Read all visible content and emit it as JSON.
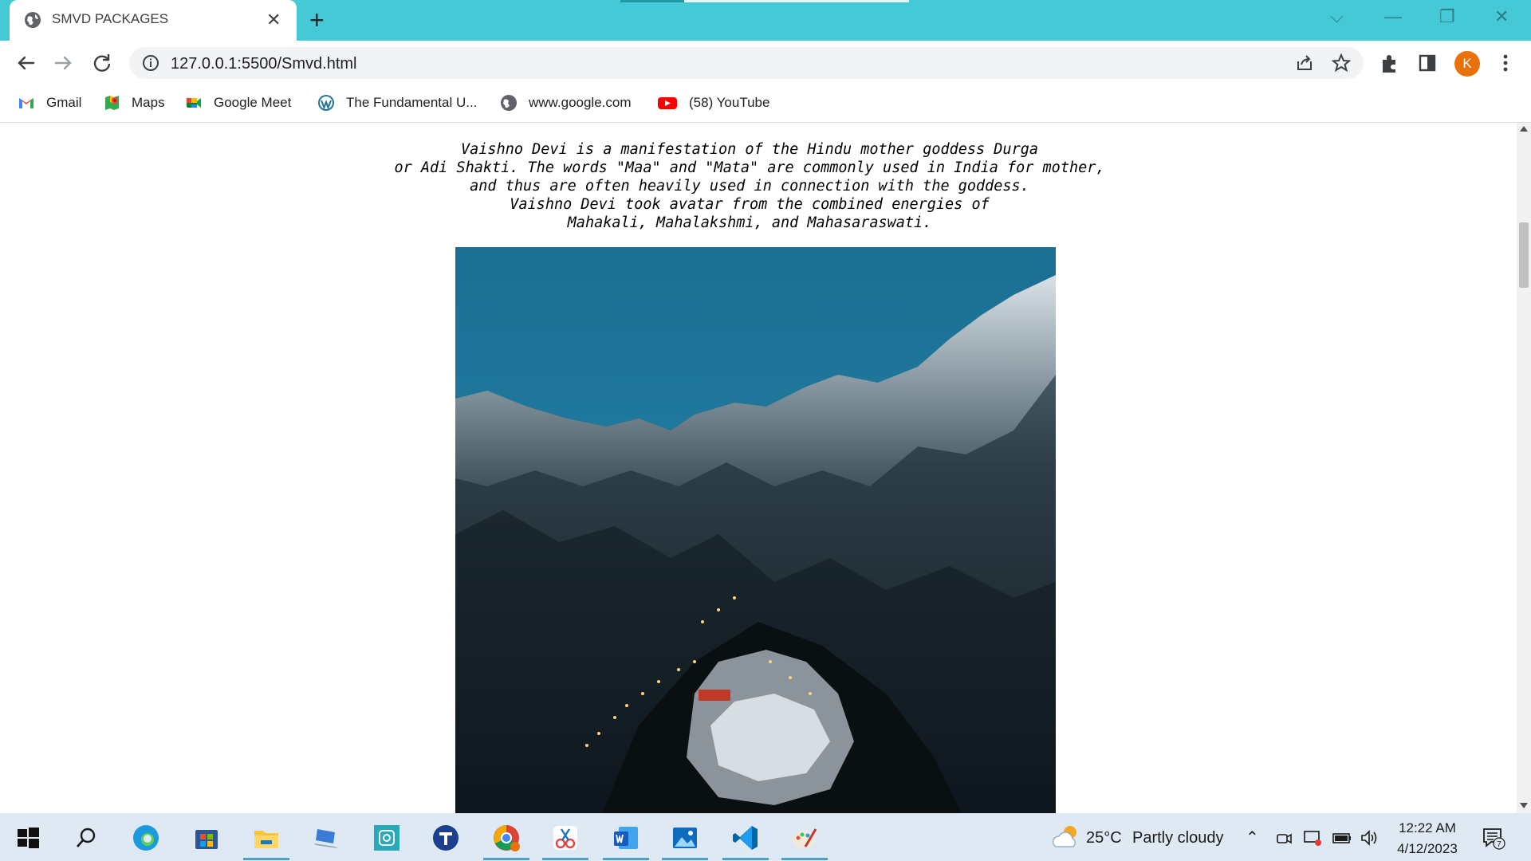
{
  "browser": {
    "tab_title": "SMVD PACKAGES",
    "tab_close": "✕",
    "new_tab": "+",
    "url": "127.0.0.1:5500/Smvd.html",
    "avatar_letter": "K",
    "window_controls": [
      "⌵",
      "—",
      "❐",
      "✕"
    ]
  },
  "bookmarks": [
    {
      "label": "Gmail",
      "icon": "gmail-icon"
    },
    {
      "label": "Maps",
      "icon": "maps-icon"
    },
    {
      "label": "Google Meet",
      "icon": "meet-icon"
    },
    {
      "label": "The Fundamental U...",
      "icon": "wordpress-icon"
    },
    {
      "label": "www.google.com",
      "icon": "globe-icon"
    },
    {
      "label": "(58) YouTube",
      "icon": "youtube-icon"
    }
  ],
  "page": {
    "intro_lines": [
      "Vaishno Devi is a manifestation of the Hindu mother goddess Durga",
      "or Adi Shakti. The words \"Maa\" and \"Mata\" are commonly used in India for mother,",
      "and thus are often heavily used in connection with the goddess.",
      "Vaishno Devi took avatar from the combined energies of",
      "Mahakali, Mahalakshmi, and Mahasaraswati."
    ]
  },
  "taskbar": {
    "weather_temp": "25°C",
    "weather_desc": "Partly cloudy",
    "time": "12:22 AM",
    "date": "4/12/2023",
    "notification_count": "7"
  },
  "colors": {
    "titlebar": "#45c9d6",
    "accent_avatar": "#e8710a",
    "taskbar": "#dfe9f3"
  }
}
